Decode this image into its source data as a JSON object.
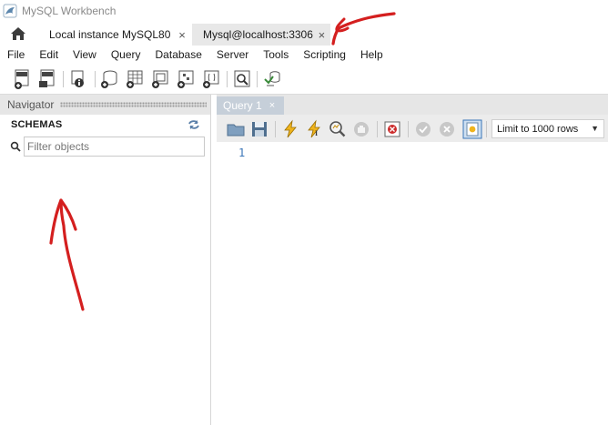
{
  "window": {
    "title": "MySQL Workbench"
  },
  "tabs": [
    {
      "label": "Local instance MySQL80",
      "close": "×"
    },
    {
      "label": "Mysql@localhost:3306",
      "close": "×"
    }
  ],
  "menu": [
    "File",
    "Edit",
    "View",
    "Query",
    "Database",
    "Server",
    "Tools",
    "Scripting",
    "Help"
  ],
  "navigator": {
    "header": "Navigator",
    "section": "SCHEMAS",
    "filter_placeholder": "Filter objects"
  },
  "query": {
    "tab_label": "Query 1",
    "tab_close": "×",
    "limit_label": "Limit to 1000 rows",
    "line_numbers": [
      "1"
    ]
  },
  "colors": {
    "query_tab_bg": "#c6cfd9",
    "line_number": "#3a76b8",
    "annotation": "#d41f1f"
  }
}
